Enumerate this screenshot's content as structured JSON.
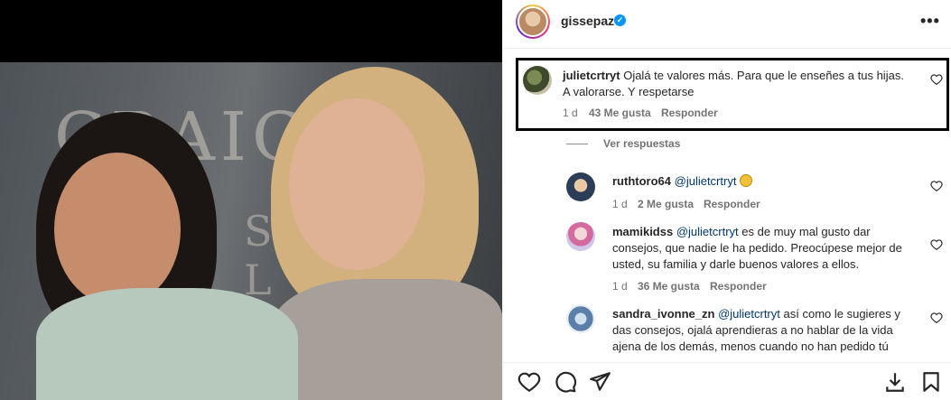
{
  "post": {
    "username": "gissepaz",
    "verified_mark": "✓",
    "more_icon": "•••"
  },
  "photo": {
    "wall_text_top": "CRAIG OU",
    "wall_text_bottom": "S C   O L"
  },
  "comments": [
    {
      "username": "julietcrtryt",
      "text": "Ojalá te valores más. Para que le enseñes a tus hijas. A valorarse. Y respetarse",
      "time": "1 d",
      "likes": "43 Me gusta",
      "reply": "Responder",
      "highlighted": true
    }
  ],
  "view_replies": "Ver respuestas",
  "replies": [
    {
      "username": "ruthtoro64",
      "mention": "@julietcrtryt",
      "text": "",
      "time": "1 d",
      "likes": "2 Me gusta",
      "reply": "Responder"
    },
    {
      "username": "mamikidss",
      "mention": "@julietcrtryt",
      "text": "es de muy mal gusto dar consejos, que nadie le ha pedido. Preocúpese mejor de usted, su familia y darle buenos valores a ellos.",
      "time": "1 d",
      "likes": "36 Me gusta",
      "reply": "Responder"
    },
    {
      "username": "sandra_ivonne_zn",
      "mention": "@julietcrtryt",
      "text": "así como le sugieres y das consejos, ojalá aprendieras a no hablar de la vida ajena de los demás, menos cuando no han pedido tú",
      "time": "",
      "likes": "",
      "reply": ""
    }
  ],
  "colors": {
    "link": "#00376b",
    "meta": "#737373",
    "verified": "#0095f6"
  },
  "actions": {
    "like_icon": "heart-icon",
    "comment_icon": "comment-icon",
    "share_icon": "share-icon",
    "download_icon": "download-icon",
    "save_icon": "bookmark-icon"
  }
}
